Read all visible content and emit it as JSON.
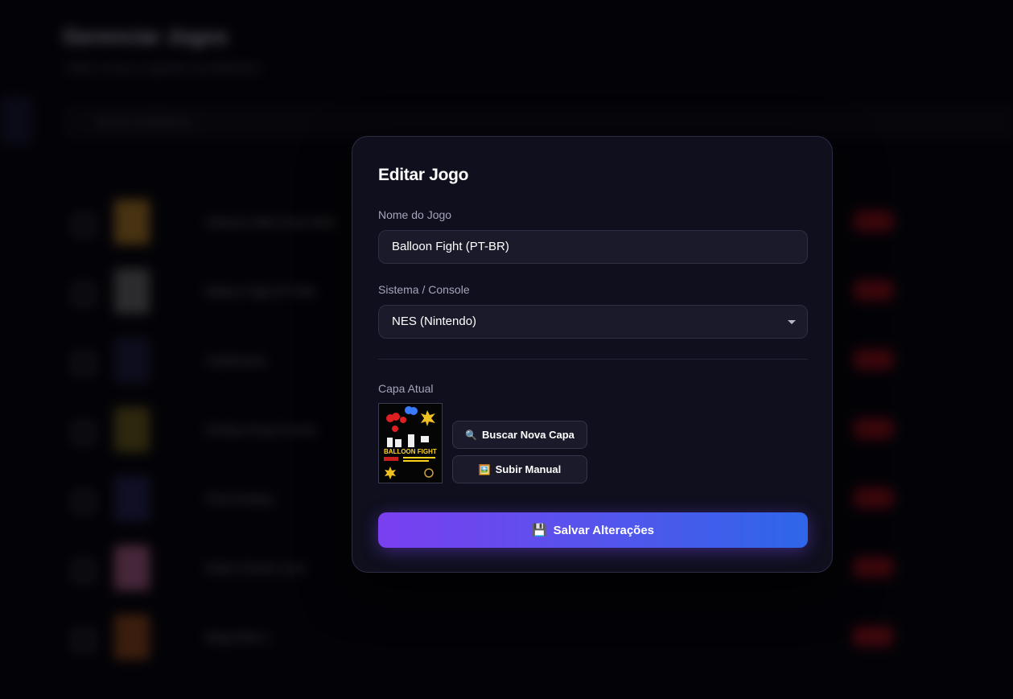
{
  "background": {
    "page_title": "Gerenciar Jogos",
    "page_subtitle": "Edite, exclua e organize sua biblioteca",
    "search_placeholder": "Buscar na biblioteca...",
    "rows": [
      {
        "name": "Advance Wars Dual Strike",
        "thumb_color": "#c58a2a"
      },
      {
        "name": "Balloon Fight (PT-BR)",
        "thumb_color": "#777777"
      },
      {
        "name": "Castlevania",
        "thumb_color": "#23234a"
      },
      {
        "name": "Donkey Kong Country",
        "thumb_color": "#7a6a20"
      },
      {
        "name": "Final Fantasy",
        "thumb_color": "#2a2a60"
      },
      {
        "name": "Kirby's Dream Land",
        "thumb_color": "#c06a9a"
      },
      {
        "name": "Mega Man 2",
        "thumb_color": "#a05020"
      }
    ]
  },
  "modal": {
    "title": "Editar Jogo",
    "name_label": "Nome do Jogo",
    "name_value": "Balloon Fight (PT-BR)",
    "system_label": "Sistema / Console",
    "system_value": "NES (Nintendo)",
    "cover_label": "Capa Atual",
    "cover_title": "BALLOON FIGHT",
    "search_cover_icon": "magnifier-icon",
    "search_cover_label": "Buscar Nova Capa",
    "upload_icon": "picture-icon",
    "upload_label": "Subir Manual",
    "save_icon": "floppy-disk-icon",
    "save_label": "Salvar Alterações"
  }
}
